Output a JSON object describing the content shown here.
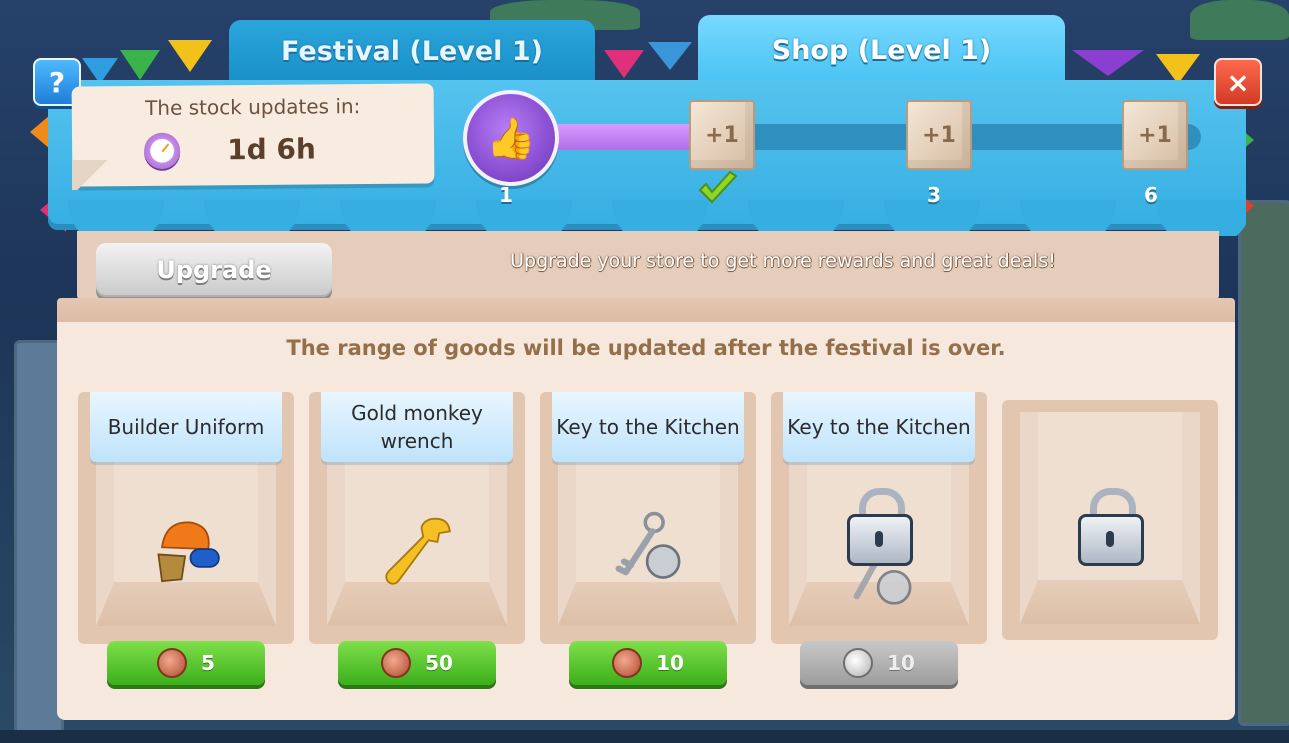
{
  "tabs": [
    {
      "label": "Festival (Level 1)",
      "active": false
    },
    {
      "label": "Shop (Level 1)",
      "active": true
    }
  ],
  "buttons": {
    "help": "?",
    "close": "×"
  },
  "stock": {
    "title": "The stock updates in:",
    "time": "1d 6h"
  },
  "progress": {
    "fill_fraction": 0.25,
    "milestones": [
      {
        "label": "1",
        "icon": "thumbs-up-icon"
      },
      {
        "box_label": "+1",
        "completed": true
      },
      {
        "box_label": "+1",
        "label": "3"
      },
      {
        "box_label": "+1",
        "label": "6"
      }
    ]
  },
  "upgrade": {
    "button_label": "Upgrade",
    "message": "Upgrade your store to get more rewards and great deals!"
  },
  "shop": {
    "notice": "The range of goods will be updated  after the festival is over.",
    "items": [
      {
        "name": "Builder Uniform",
        "icon": "builder-uniform-icon",
        "price": "5",
        "currency": "copper-coin",
        "available": true
      },
      {
        "name": "Gold monkey wrench",
        "icon": "wrench-icon",
        "price": "50",
        "currency": "copper-coin",
        "available": true
      },
      {
        "name": "Key to the Kitchen",
        "icon": "key-icon",
        "price": "10",
        "currency": "copper-coin",
        "available": true
      },
      {
        "name": "Key to the Kitchen",
        "icon": "key-icon",
        "price": "10",
        "currency": "silver-coin",
        "available": false,
        "locked": true
      },
      {
        "locked": true,
        "empty": true
      }
    ]
  },
  "colors": {
    "header_blue": "#36aee2",
    "progress_purple": "#b06ee8",
    "price_green": "#3cae1c",
    "price_gray": "#9d9d9d",
    "panel_cream": "#f6e8dc"
  }
}
